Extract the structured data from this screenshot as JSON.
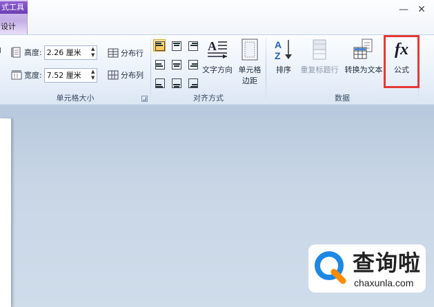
{
  "titlebar": {
    "context_tab_title": "式工具",
    "design_tab": "设计",
    "minimize_glyph": "—",
    "close_glyph": "✕"
  },
  "ribbon": {
    "cell_size_group": {
      "label": "单元格大小",
      "height_label": "高度:",
      "height_value": "2.26 厘米",
      "width_label": "宽度:",
      "width_value": "7.52 厘米",
      "distribute_rows": "分布行",
      "distribute_columns": "分布列"
    },
    "alignment_group": {
      "label": "对齐方式",
      "text_direction": "文字方向",
      "cell_margins_line1": "单元格",
      "cell_margins_line2": "边距"
    },
    "data_group": {
      "label": "数据",
      "sort": "排序",
      "repeat_header_rows": "重复标题行",
      "convert_to_text": "转换为文本",
      "formula": "公式",
      "formula_glyph": "fx"
    }
  },
  "watermark": {
    "brand_cn": "查询啦",
    "brand_url": "chaxunla.com"
  },
  "colors": {
    "highlight_border": "#e53935",
    "context_tab": "#6c3fb5",
    "logo_blue": "#1e88e5",
    "logo_orange": "#fb8c00"
  }
}
